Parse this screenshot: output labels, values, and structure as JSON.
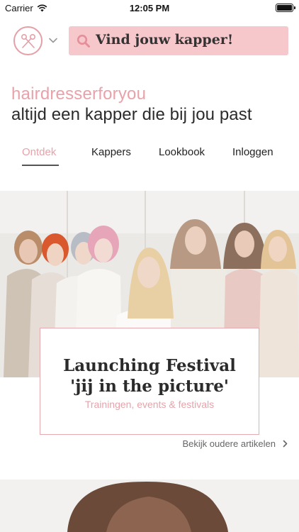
{
  "status_bar": {
    "carrier": "Carrier",
    "time": "12:05 PM"
  },
  "header": {
    "logo_icon": "scissors-icon",
    "menu_icon": "chevron-down-icon",
    "search": {
      "icon": "search-icon",
      "label": "Vind jouw kapper!"
    }
  },
  "intro": {
    "brand": "hairdresserforyou",
    "tagline": "altijd een kapper die bij jou past"
  },
  "tabs": [
    {
      "label": "Ontdek",
      "active": true
    },
    {
      "label": "Kappers",
      "active": false
    },
    {
      "label": "Lookbook",
      "active": false
    },
    {
      "label": "Inloggen",
      "active": false
    }
  ],
  "featured": {
    "title_line1": "Launching Festival",
    "title_line2": "'jij in the picture'",
    "category": "Trainingen, events & festivals"
  },
  "older_articles": {
    "label": "Bekijk oudere artikelen",
    "icon": "chevron-right-icon"
  },
  "colors": {
    "accent_pink": "#e8a2aa",
    "search_bg": "#f6c7cb",
    "text_dark": "#2b2b2b"
  }
}
